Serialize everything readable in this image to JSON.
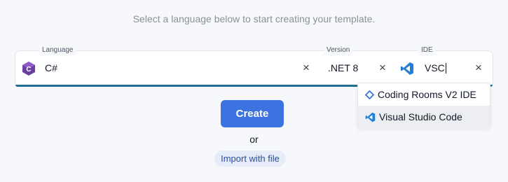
{
  "subtitle": "Select a language below to start creating your template.",
  "selector": {
    "language": {
      "label": "Language",
      "value": "C#",
      "icon": "csharp-icon"
    },
    "version": {
      "label": "Version",
      "value": ".NET 8"
    },
    "ide": {
      "label": "IDE",
      "value": "VSC",
      "icon": "vscode-icon"
    },
    "clear_symbol": "×",
    "accent_color": "#1e6f93"
  },
  "dropdown": {
    "options": [
      {
        "label": "Coding Rooms V2 IDE",
        "icon": "coding-rooms-icon",
        "highlighted": false
      },
      {
        "label": "Visual Studio Code",
        "icon": "vscode-icon",
        "highlighted": true
      }
    ]
  },
  "actions": {
    "create_label": "Create",
    "or_text": "or",
    "import_label": "Import with file",
    "primary_color": "#3d73e0"
  }
}
